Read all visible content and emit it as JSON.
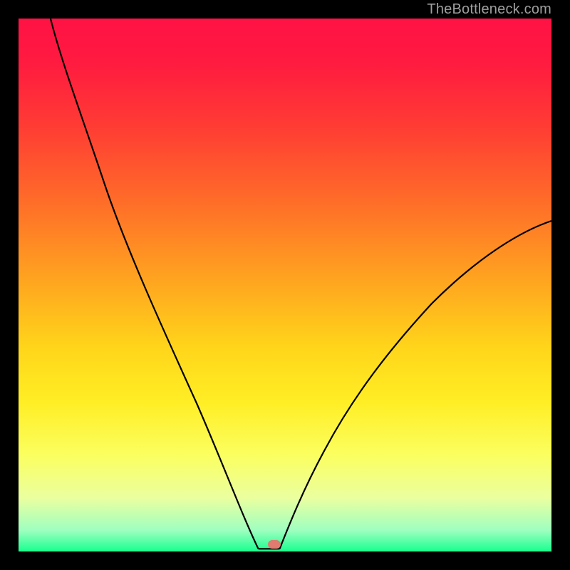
{
  "watermark": {
    "text": "TheBottleneck.com"
  },
  "chart_data": {
    "type": "line",
    "title": "",
    "xlabel": "",
    "ylabel": "",
    "xlim": [
      0,
      100
    ],
    "ylim": [
      0,
      100
    ],
    "grid": false,
    "legend": false,
    "series": [
      {
        "name": "left-branch",
        "x": [
          6,
          10,
          15,
          20,
          25,
          30,
          34,
          38,
          41,
          43.5,
          45
        ],
        "y": [
          100,
          90,
          78,
          65,
          52,
          38,
          27,
          16,
          8,
          3,
          0.5
        ]
      },
      {
        "name": "valley-floor",
        "x": [
          45,
          49
        ],
        "y": [
          0.5,
          0.5
        ]
      },
      {
        "name": "right-branch",
        "x": [
          49,
          52,
          56,
          60,
          65,
          70,
          76,
          83,
          90,
          97,
          100
        ],
        "y": [
          0.5,
          6,
          13,
          20,
          28,
          35,
          42,
          49,
          55,
          60,
          62
        ]
      }
    ],
    "marker": {
      "x": 48,
      "y": 0.5,
      "color": "#df7b6f"
    },
    "background_gradient": {
      "top": "#ff1244",
      "upper_mid": "#ff6f28",
      "mid": "#ffd61a",
      "lower_mid": "#fbff60",
      "bottom": "#18ff8f"
    }
  }
}
